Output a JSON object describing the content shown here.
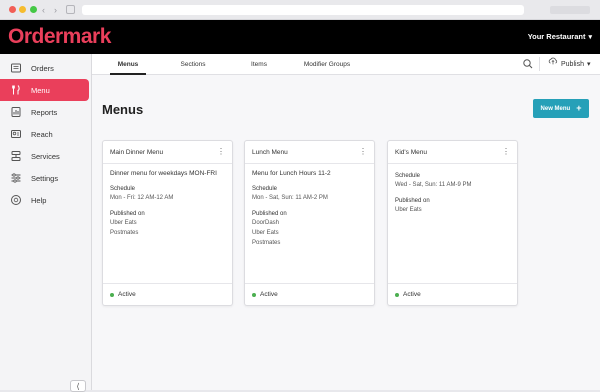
{
  "app": {
    "logo": "Ordermark",
    "restaurant": "Your Restaurant",
    "accent": "#ea3f5b",
    "header_bg": "#000000",
    "button_color": "#26a0b8",
    "status_color": "#4caf50"
  },
  "sidebar": {
    "items": [
      {
        "label": "Orders",
        "icon": "orders-icon"
      },
      {
        "label": "Menu",
        "icon": "menu-icon",
        "active": true
      },
      {
        "label": "Reports",
        "icon": "reports-icon"
      },
      {
        "label": "Reach",
        "icon": "reach-icon"
      },
      {
        "label": "Services",
        "icon": "services-icon"
      },
      {
        "label": "Settings",
        "icon": "settings-icon"
      },
      {
        "label": "Help",
        "icon": "help-icon"
      }
    ],
    "collapse_icon": "collapse-icon"
  },
  "subnav": {
    "tabs": [
      {
        "label": "Menus",
        "active": true
      },
      {
        "label": "Sections"
      },
      {
        "label": "Items"
      },
      {
        "label": "Modifier Groups"
      }
    ],
    "publish_label": "Publish"
  },
  "main": {
    "title": "Menus",
    "new_menu_label": "New Menu",
    "cards": [
      {
        "title": "Main Dinner Menu",
        "description": "Dinner menu for weekdays MON-FRI",
        "schedule_label": "Schedule",
        "schedule": "Mon - Fri: 12 AM-12 AM",
        "published_label": "Published on",
        "platforms": [
          "Uber Eats",
          "Postmates"
        ],
        "status": "Active"
      },
      {
        "title": "Lunch Menu",
        "description": "Menu for Lunch Hours 11-2",
        "schedule_label": "Schedule",
        "schedule": "Mon - Sat, Sun: 11 AM-2 PM",
        "published_label": "Published on",
        "platforms": [
          "DoorDash",
          "Uber Eats",
          "Postmates"
        ],
        "status": "Active"
      },
      {
        "title": "Kid's Menu",
        "description": "",
        "schedule_label": "Schedule",
        "schedule": "Wed - Sat, Sun: 11 AM-9 PM",
        "published_label": "Published on",
        "platforms": [
          "Uber Eats"
        ],
        "status": "Active"
      }
    ]
  }
}
